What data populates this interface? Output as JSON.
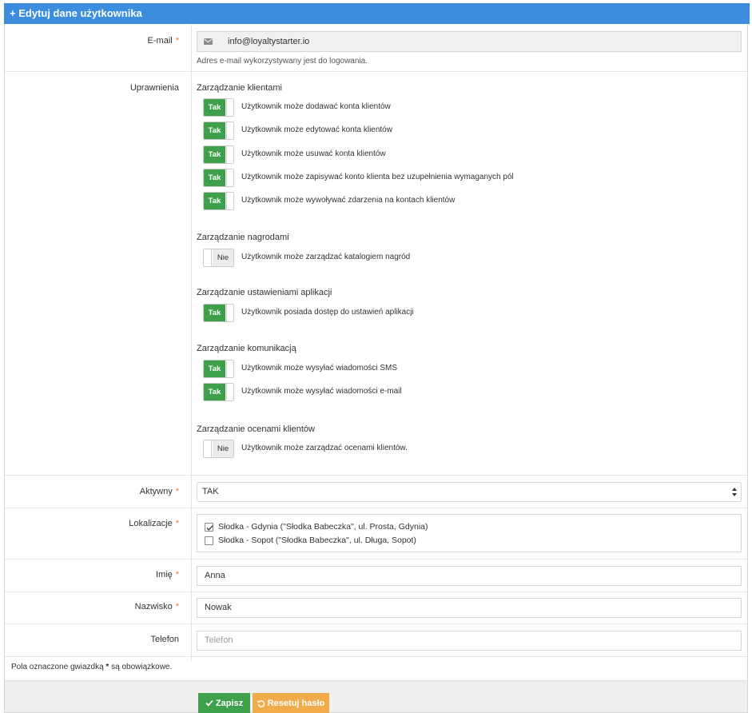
{
  "panel": {
    "title": "+ Edytuj dane użytkownika"
  },
  "email": {
    "label": "E-mail",
    "required_mark": "*",
    "icon": "envelope-icon",
    "value": "info@loyaltystarter.io",
    "help": "Adres e-mail wykorzystywany jest do logowania."
  },
  "permissions": {
    "label": "Uprawnienia",
    "groups": [
      {
        "title": "Zarządzanie klientami",
        "items": [
          {
            "state": "Tak",
            "on": true,
            "text": "Użytkownik może dodawać konta klientów"
          },
          {
            "state": "Tak",
            "on": true,
            "text": "Użytkownik może edytować konta klientów"
          },
          {
            "state": "Tak",
            "on": true,
            "text": "Użytkownik może usuwać konta klientów"
          },
          {
            "state": "Tak",
            "on": true,
            "text": "Użytkownik może zapisywać konto klienta bez uzupełnienia wymaganych pól"
          },
          {
            "state": "Tak",
            "on": true,
            "text": "Użytkownik może wywoływać zdarzenia na kontach klientów"
          }
        ]
      },
      {
        "title": "Zarządzanie nagrodami",
        "items": [
          {
            "state": "Nie",
            "on": false,
            "text": "Użytkownik może zarządzać katalogiem nagród"
          }
        ]
      },
      {
        "title": "Zarządzanie ustawieniami aplikacji",
        "items": [
          {
            "state": "Tak",
            "on": true,
            "text": "Użytkownik posiada dostęp do ustawień aplikacji"
          }
        ]
      },
      {
        "title": "Zarządzanie komunikacją",
        "items": [
          {
            "state": "Tak",
            "on": true,
            "text": "Użytkownik może wysyłać wiadomości SMS"
          },
          {
            "state": "Tak",
            "on": true,
            "text": "Użytkownik może wysyłać wiadomości e-mail"
          }
        ]
      },
      {
        "title": "Zarządzanie ocenami klientów",
        "items": [
          {
            "state": "Nie",
            "on": false,
            "text": "Użytkownik może zarządzać ocenami klientów."
          }
        ]
      }
    ]
  },
  "active": {
    "label": "Aktywny",
    "required_mark": "*",
    "value": "TAK"
  },
  "locations": {
    "label": "Lokalizacje",
    "required_mark": "*",
    "options": [
      {
        "text": "Słodka - Gdynia (\"Słodka Babeczka\", ul. Prosta, Gdynia)",
        "checked": true
      },
      {
        "text": "Słodka - Sopot (\"Słodka Babeczka\", ul. Długa, Sopot)",
        "checked": false
      }
    ]
  },
  "first_name": {
    "label": "Imię",
    "required_mark": "*",
    "value": "Anna"
  },
  "last_name": {
    "label": "Nazwisko",
    "required_mark": "*",
    "value": "Nowak"
  },
  "phone": {
    "label": "Telefon",
    "value": "",
    "placeholder": "Telefon"
  },
  "footnote": {
    "before": "Pola oznaczone gwiazdką",
    "star": "*",
    "after": "są obowiązkowe."
  },
  "buttons": {
    "save": "Zapisz",
    "reset": "Resetuj hasło"
  },
  "colors": {
    "header": "#3c8dde",
    "toggle_on": "#3fa04c",
    "required": "#e8742a",
    "save": "#3fa04c",
    "reset": "#f0ab4a"
  }
}
